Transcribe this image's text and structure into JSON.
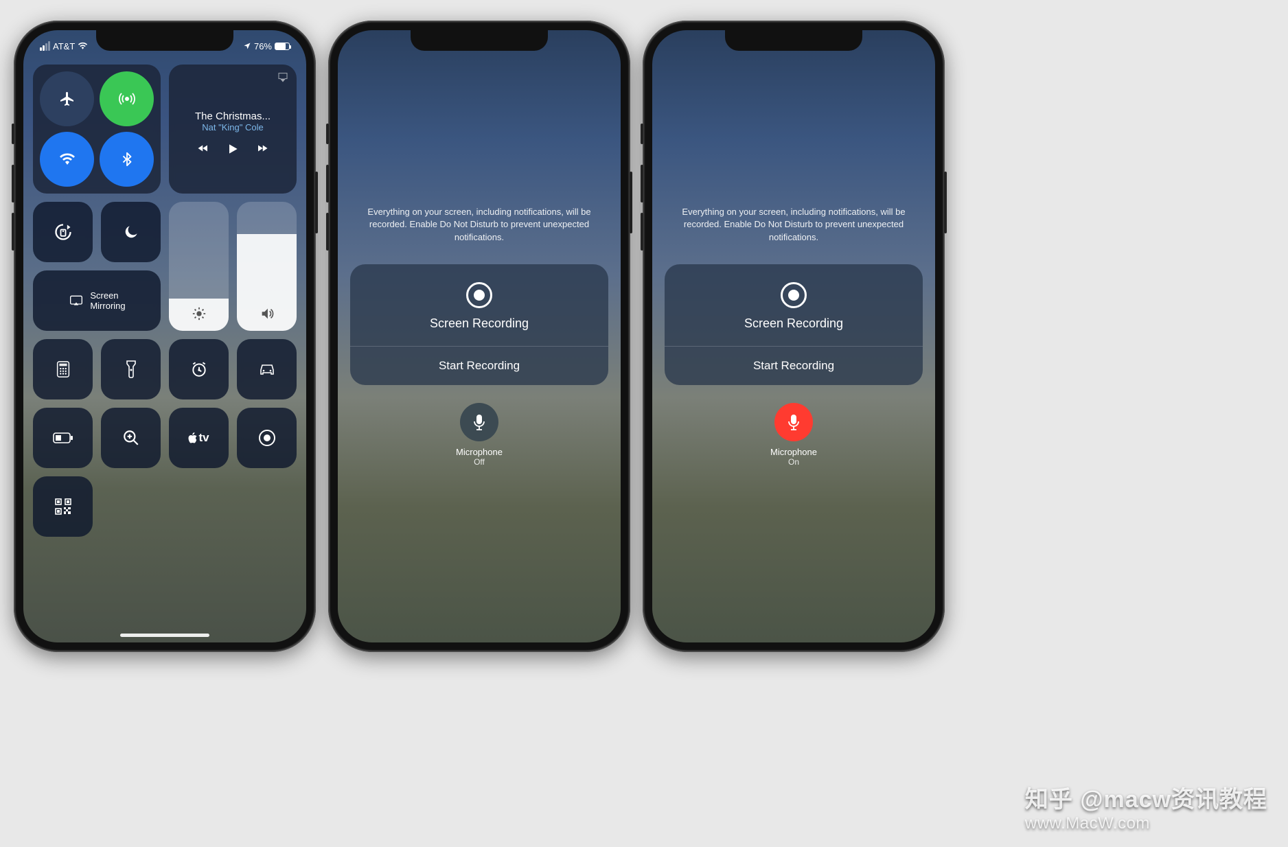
{
  "statusbar": {
    "carrier": "AT&T",
    "battery_pct": "76%"
  },
  "controlCenter": {
    "music": {
      "title": "The Christmas...",
      "artist": "Nat \"King\" Cole"
    },
    "mirror_label": "Screen\nMirroring",
    "toggles": {
      "airplane": "airplane-icon",
      "cellular": "cellular-icon",
      "wifi": "wifi-icon",
      "bluetooth": "bluetooth-icon",
      "rotation": "rotation-lock-icon",
      "dnd": "moon-icon",
      "brightness": "brightness-icon",
      "volume": "volume-icon"
    },
    "tiles": [
      "calculator",
      "flashlight",
      "alarm",
      "car",
      "low-power",
      "magnifier",
      "apple-tv",
      "screen-record",
      "qr-code"
    ]
  },
  "recording": {
    "notice": "Everything on your screen, including notifications, will be recorded. Enable Do Not Disturb to prevent unexpected notifications.",
    "title": "Screen Recording",
    "start": "Start Recording",
    "mic_label": "Microphone",
    "mic_off": "Off",
    "mic_on": "On"
  },
  "watermark": {
    "brand": "知乎 @macw资讯教程",
    "url": "www.MacW.com"
  }
}
